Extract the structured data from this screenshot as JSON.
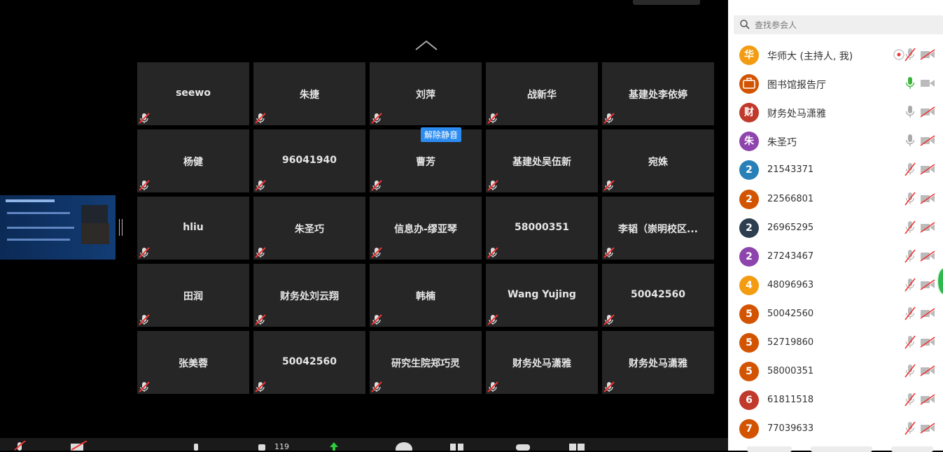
{
  "gallery": {
    "unmute_label": "解除静音",
    "tiles": [
      {
        "name": "seewo"
      },
      {
        "name": "朱捷"
      },
      {
        "name": "刘萍"
      },
      {
        "name": "战新华"
      },
      {
        "name": "基建处李依婷"
      },
      {
        "name": "杨健"
      },
      {
        "name": "96041940"
      },
      {
        "name": "曹芳"
      },
      {
        "name": "基建处吴伍新"
      },
      {
        "name": "宛姝"
      },
      {
        "name": "hliu"
      },
      {
        "name": "朱圣巧"
      },
      {
        "name": "信息办-缪亚琴"
      },
      {
        "name": "58000351"
      },
      {
        "name": "李韬（崇明校区..."
      },
      {
        "name": "田润"
      },
      {
        "name": "财务处刘云翔"
      },
      {
        "name": "韩楠"
      },
      {
        "name": "Wang Yujing"
      },
      {
        "name": "50042560"
      },
      {
        "name": "张美蓉"
      },
      {
        "name": "50042560"
      },
      {
        "name": "研究生院郑巧灵"
      },
      {
        "name": "财务处马潇雅"
      },
      {
        "name": "财务处马潇雅"
      }
    ]
  },
  "toolbar": {
    "participant_count": "119"
  },
  "participants_panel": {
    "search_placeholder": "查找参会人",
    "participants": [
      {
        "avatar": "华",
        "color": "#f39c12",
        "name": "华师大 (主持人, 我)"
      },
      {
        "avatar": "",
        "color": "#d35400",
        "name": "图书馆报告厅"
      },
      {
        "avatar": "财",
        "color": "#c0392b",
        "name": "财务处马潇雅"
      },
      {
        "avatar": "朱",
        "color": "#8e44ad",
        "name": "朱圣巧"
      },
      {
        "avatar": "2",
        "color": "#2980b9",
        "name": "21543371"
      },
      {
        "avatar": "2",
        "color": "#d35400",
        "name": "22566801"
      },
      {
        "avatar": "2",
        "color": "#2c3e50",
        "name": "26965295"
      },
      {
        "avatar": "2",
        "color": "#8e44ad",
        "name": "27243467"
      },
      {
        "avatar": "4",
        "color": "#f39c12",
        "name": "48096963"
      },
      {
        "avatar": "5",
        "color": "#d35400",
        "name": "50042560"
      },
      {
        "avatar": "5",
        "color": "#d35400",
        "name": "52719860"
      },
      {
        "avatar": "5",
        "color": "#d35400",
        "name": "58000351"
      },
      {
        "avatar": "6",
        "color": "#c0392b",
        "name": "61811518"
      },
      {
        "avatar": "7",
        "color": "#d35400",
        "name": "77039633"
      }
    ]
  }
}
